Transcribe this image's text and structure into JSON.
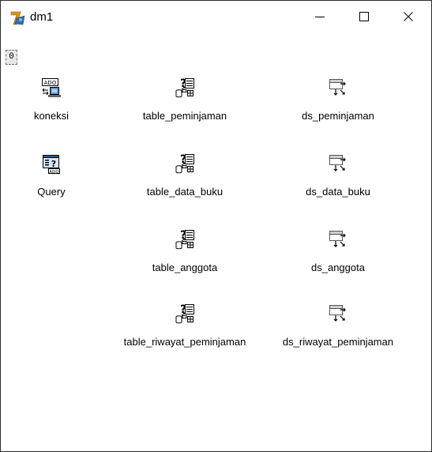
{
  "window": {
    "title": "dm1",
    "icons": {
      "app": "delphi-app-icon",
      "minimize": "minimize-icon",
      "maximize": "maximize-icon",
      "close": "close-icon"
    }
  },
  "designer": {
    "corner_label": "0",
    "components": {
      "koneksi": "koneksi",
      "query": "Query",
      "table_peminjaman": "table_peminjaman",
      "table_data_buku": "table_data_buku",
      "table_anggota": "table_anggota",
      "table_riwayat_peminjaman": "table_riwayat_peminjaman",
      "ds_peminjaman": "ds_peminjaman",
      "ds_data_buku": "ds_data_buku",
      "ds_anggota": "ds_anggota",
      "ds_riwayat_peminjaman": "ds_riwayat_peminjaman"
    },
    "icon_labels": {
      "ado": "ADO",
      "query_mark": "?"
    }
  }
}
